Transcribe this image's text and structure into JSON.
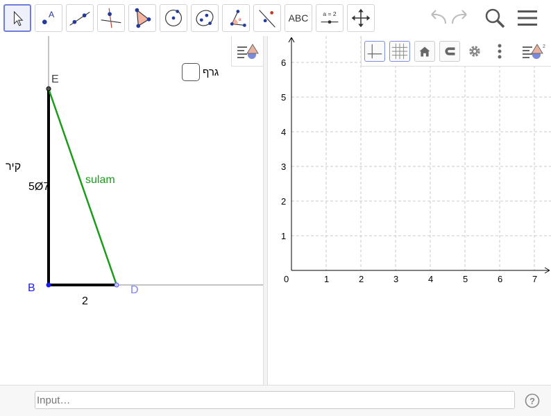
{
  "toolbar": {
    "tools": [
      {
        "name": "move-tool",
        "active": true
      },
      {
        "name": "point-tool",
        "glyph": "A"
      },
      {
        "name": "line-tool"
      },
      {
        "name": "perpendicular-tool"
      },
      {
        "name": "polygon-tool"
      },
      {
        "name": "circle-tool"
      },
      {
        "name": "conic-tool"
      },
      {
        "name": "angle-tool"
      },
      {
        "name": "reflect-tool"
      },
      {
        "name": "text-tool",
        "label": "ABC"
      },
      {
        "name": "slider-tool",
        "label": "a = 2"
      },
      {
        "name": "move-graphics-tool"
      }
    ],
    "undo_icon": "undo-icon",
    "redo_icon": "redo-icon",
    "search_icon": "search-icon",
    "menu_icon": "hamburger-menu-icon"
  },
  "graphics1": {
    "checkbox": {
      "label": "גרף",
      "checked": false
    },
    "points": {
      "E": "E",
      "B": "B",
      "D": "D"
    },
    "wall_label": "קיר",
    "wall_value": "5Ø7",
    "ladder_label": "sulam",
    "base_value": "2",
    "colors": {
      "ladder": "#1a9c1a",
      "point_blue": "#0000ff",
      "point_d": "#7f7fff",
      "wall": "#000000"
    }
  },
  "graphics2": {
    "stylebar": [
      "axes-toggle-icon",
      "grid-toggle-icon",
      "home-icon",
      "magnet-icon",
      "gear-icon",
      "more-vert-icon",
      "style-bar-toggle-icon"
    ],
    "x_ticks": [
      "0",
      "1",
      "2",
      "3",
      "4",
      "5",
      "6",
      "7"
    ],
    "y_ticks": [
      "1",
      "2",
      "3",
      "4",
      "5",
      "6"
    ]
  },
  "inputbar": {
    "placeholder": "Input…",
    "help_icon": "help-icon"
  }
}
